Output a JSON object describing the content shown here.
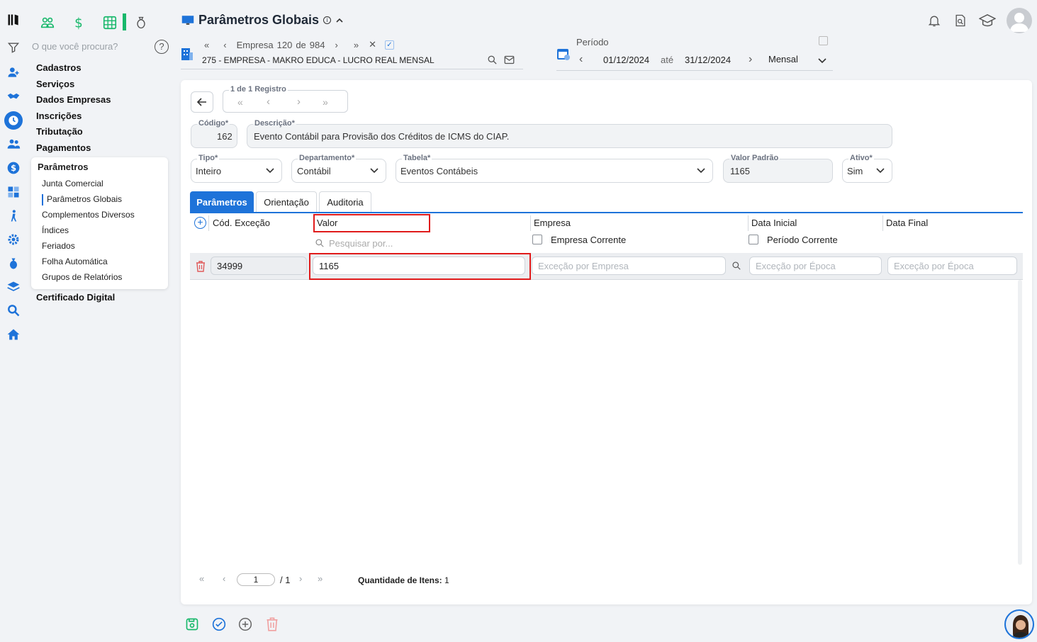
{
  "search": {
    "placeholder": "O que você procura?"
  },
  "title": {
    "text": "Parâmetros Globais"
  },
  "menu": {
    "items": [
      "Cadastros",
      "Serviços",
      "Dados Empresas",
      "Inscrições",
      "Tributação",
      "Pagamentos"
    ],
    "submenu_title": "Parâmetros",
    "submenu_items": [
      "Junta Comercial",
      "Parâmetros Globais",
      "Complementos Diversos",
      "Índices",
      "Feriados",
      "Folha Automática",
      "Grupos de Relatórios"
    ],
    "after": "Certificado Digital"
  },
  "company": {
    "nav_label": "Empresa",
    "nav_current": "120",
    "nav_de": "de",
    "nav_total": "984",
    "name": "275 - EMPRESA - MAKRO EDUCA - LUCRO REAL MENSAL"
  },
  "period": {
    "label": "Período",
    "start": "01/12/2024",
    "ate": "até",
    "end": "31/12/2024",
    "frequency": "Mensal"
  },
  "record_nav": {
    "label": "1 de 1 Registro"
  },
  "form": {
    "codigo": {
      "label": "Código*",
      "value": "162"
    },
    "descricao": {
      "label": "Descrição*",
      "value": "Evento Contábil para Provisão dos Créditos de ICMS do CIAP."
    },
    "tipo": {
      "label": "Tipo*",
      "value": "Inteiro"
    },
    "departamento": {
      "label": "Departamento*",
      "value": "Contábil"
    },
    "tabela": {
      "label": "Tabela*",
      "value": "Eventos Contábeis"
    },
    "valor_padrao": {
      "label": "Valor Padrão",
      "value": "1165"
    },
    "ativo": {
      "label": "Ativo*",
      "value": "Sim"
    }
  },
  "tabs": [
    "Parâmetros",
    "Orientação",
    "Auditoria"
  ],
  "grid": {
    "columns": {
      "cod": "Cód. Exceção",
      "valor": "Valor",
      "empresa": "Empresa",
      "data_inicial": "Data Inicial",
      "data_final": "Data Final"
    },
    "search_placeholder": "Pesquisar por...",
    "empresa_corrente": "Empresa Corrente",
    "periodo_corrente": "Período Corrente",
    "rows": [
      {
        "cod": "34999",
        "valor": "1165",
        "empresa_ph": "Exceção por Empresa",
        "data_inicial_ph": "Exceção por Época",
        "data_final_ph": "Exceção por Época"
      }
    ]
  },
  "pager": {
    "page": "1",
    "of": "/ 1",
    "qty_label": "Quantidade de Itens:",
    "qty": "1"
  },
  "colors": {
    "accent": "#1e73d9",
    "green": "#18b86b",
    "red": "#e01b1b"
  }
}
